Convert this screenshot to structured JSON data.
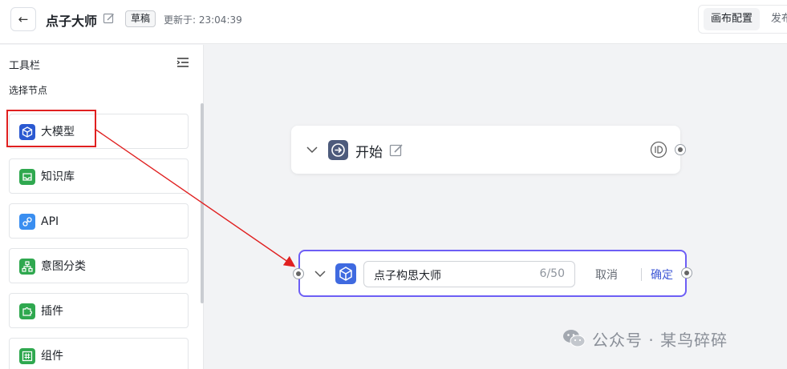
{
  "header": {
    "back_label": "←",
    "title": "点子大师",
    "draft_badge": "草稿",
    "updated_text": "更新于: 23:04:39",
    "canvas_config": "画布配置",
    "publish": "发布"
  },
  "sidebar": {
    "title": "工具栏",
    "subtitle": "选择节点",
    "items": [
      {
        "label": "大模型",
        "icon": "cube-icon",
        "color": "#2b59d1"
      },
      {
        "label": "知识库",
        "icon": "inbox-icon",
        "color": "#2fa84f"
      },
      {
        "label": "API",
        "icon": "link-icon",
        "color": "#3a8ef0"
      },
      {
        "label": "意图分类",
        "icon": "hierarchy-icon",
        "color": "#2fa84f"
      },
      {
        "label": "插件",
        "icon": "puzzle-icon",
        "color": "#2fa84f"
      },
      {
        "label": "组件",
        "icon": "hash-icon",
        "color": "#2fa84f"
      }
    ]
  },
  "canvas": {
    "start_node": {
      "label": "开始"
    },
    "llm_node": {
      "name_value": "点子构思大师",
      "char_count": "6/50",
      "cancel": "取消",
      "confirm": "确定"
    }
  },
  "watermark": {
    "text": "公众号 · 某鸟碎碎"
  },
  "colors": {
    "accent": "#6d5ef5",
    "annotation": "#e02020"
  }
}
